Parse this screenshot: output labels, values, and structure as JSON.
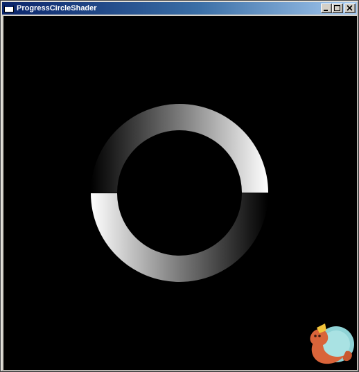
{
  "window": {
    "title": "ProgressCircleShader"
  },
  "icons": {
    "app": "app-window-icon",
    "minimize": "minimize-icon",
    "maximize": "maximize-icon",
    "close": "close-icon",
    "mascot": "platypus-mascot-icon"
  },
  "colors": {
    "titlebar_start": "#0a246a",
    "titlebar_end": "#a6caf0",
    "canvas_background": "#000000",
    "ring_dark": "#000000",
    "ring_light": "#ffffff"
  }
}
